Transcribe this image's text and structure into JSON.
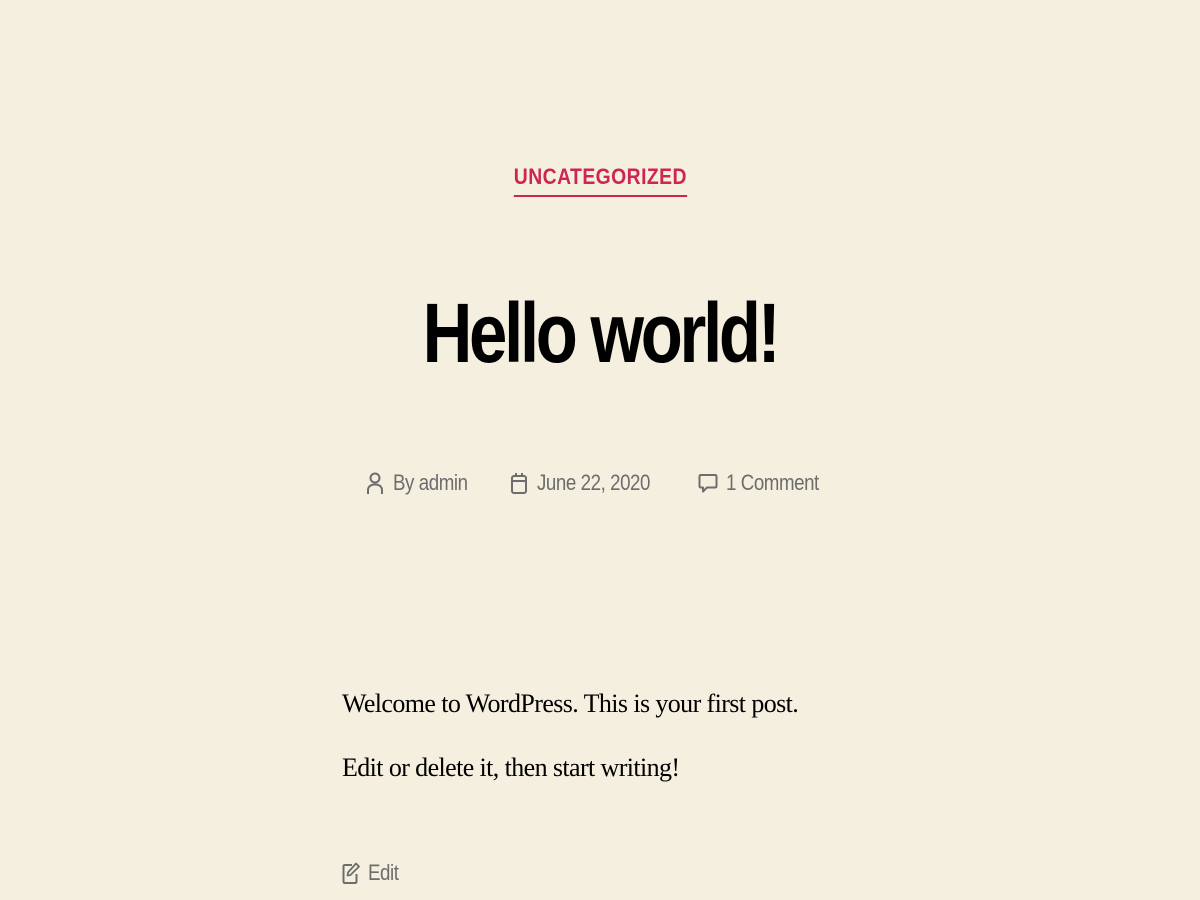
{
  "post": {
    "category": "UNCATEGORIZED",
    "title": "Hello world!",
    "meta": {
      "author": "By admin",
      "date": "June 22, 2020",
      "comments": "1 Comment"
    },
    "content": "Welcome to WordPress. This is your first post. Edit or delete it, then start writing!",
    "edit_label": "Edit"
  },
  "colors": {
    "background": "#f5efe0",
    "accent": "#cd2653",
    "meta_text": "#6d6d6d",
    "body_text": "#000000"
  },
  "icons": {
    "author": "user-icon",
    "date": "calendar-icon",
    "comments": "comment-icon",
    "edit": "edit-icon"
  }
}
